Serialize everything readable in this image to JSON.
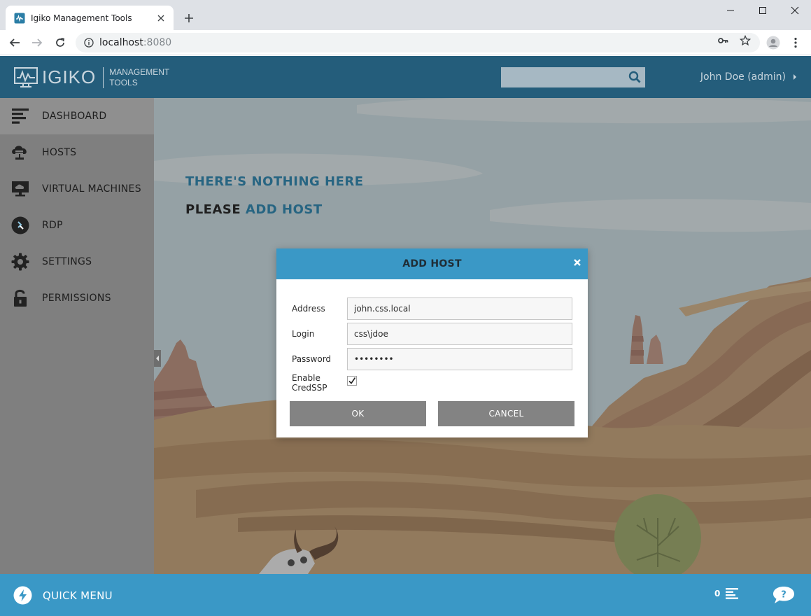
{
  "browser": {
    "tab_title": "Igiko Management Tools",
    "url_host": "localhost",
    "url_port": ":8080"
  },
  "header": {
    "logo_word": "IGIKO",
    "logo_sub_line1": "MANAGEMENT",
    "logo_sub_line2": "TOOLS",
    "search_value": "",
    "user_label": "John Doe (admin)"
  },
  "sidebar": {
    "items": [
      {
        "label": "DASHBOARD",
        "icon": "dashboard-icon"
      },
      {
        "label": "HOSTS",
        "icon": "hosts-icon"
      },
      {
        "label": "VIRTUAL MACHINES",
        "icon": "virtual-machines-icon"
      },
      {
        "label": "RDP",
        "icon": "rdp-icon"
      },
      {
        "label": "SETTINGS",
        "icon": "gear-icon"
      },
      {
        "label": "PERMISSIONS",
        "icon": "lock-icon"
      }
    ]
  },
  "main": {
    "empty_title": "THERE'S NOTHING HERE",
    "cta_prefix": "PLEASE ",
    "cta_link": "ADD HOST"
  },
  "dialog": {
    "title": "ADD HOST",
    "address_label": "Address",
    "address_value": "john.css.local",
    "login_label": "Login",
    "login_value": "css\\jdoe",
    "password_label": "Password",
    "password_value": "password",
    "credssp_label": "Enable CredSSP",
    "credssp_checked": true,
    "ok_label": "OK",
    "cancel_label": "CANCEL"
  },
  "bottombar": {
    "quick_menu_label": "QUICK MENU",
    "queue_count": "0"
  },
  "colors": {
    "header": "#245d7b",
    "accent": "#3a98c6",
    "sidebar": "#7f7f7f",
    "link": "#276582"
  }
}
